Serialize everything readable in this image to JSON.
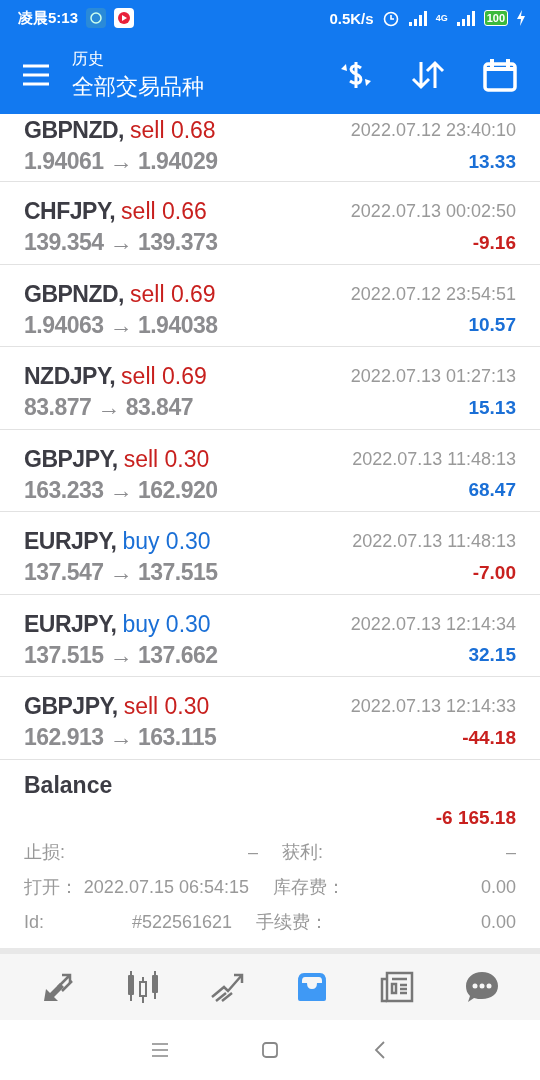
{
  "status_bar": {
    "time": "凌晨5:13",
    "speed": "0.5K/s",
    "network": "4G",
    "battery": "100"
  },
  "header": {
    "subtitle": "历史",
    "title": "全部交易品种"
  },
  "trades": [
    {
      "symbol": "GBPNZD,",
      "side": "sell 0.68",
      "kind": "sell",
      "prices": "1.94061 → 1.94029",
      "time": "2022.07.12 23:40:10",
      "profit": "13.33",
      "color": "#1a6fd6"
    },
    {
      "symbol": "CHFJPY,",
      "side": "sell 0.66",
      "kind": "sell",
      "prices": "139.354 → 139.373",
      "time": "2022.07.13 00:02:50",
      "profit": "-9.16",
      "color": "#c8201e"
    },
    {
      "symbol": "GBPNZD,",
      "side": "sell 0.69",
      "kind": "sell",
      "prices": "1.94063 → 1.94038",
      "time": "2022.07.12 23:54:51",
      "profit": "10.57",
      "color": "#1a6fd6"
    },
    {
      "symbol": "NZDJPY,",
      "side": "sell 0.69",
      "kind": "sell",
      "prices": "83.877 → 83.847",
      "time": "2022.07.13 01:27:13",
      "profit": "15.13",
      "color": "#1a6fd6"
    },
    {
      "symbol": "GBPJPY,",
      "side": "sell 0.30",
      "kind": "sell",
      "prices": "163.233 → 162.920",
      "time": "2022.07.13 11:48:13",
      "profit": "68.47",
      "color": "#1a6fd6"
    },
    {
      "symbol": "EURJPY,",
      "side": "buy 0.30",
      "kind": "buy",
      "prices": "137.547 → 137.515",
      "time": "2022.07.13 11:48:13",
      "profit": "-7.00",
      "color": "#c8201e"
    },
    {
      "symbol": "EURJPY,",
      "side": "buy 0.30",
      "kind": "buy",
      "prices": "137.515 → 137.662",
      "time": "2022.07.13 12:14:34",
      "profit": "32.15",
      "color": "#1a6fd6"
    },
    {
      "symbol": "GBPJPY,",
      "side": "sell 0.30",
      "kind": "sell",
      "prices": "162.913 → 163.115",
      "time": "2022.07.13 12:14:33",
      "profit": "-44.18",
      "color": "#c8201e"
    }
  ],
  "balance": {
    "title": "Balance",
    "amount": "-6 165.18",
    "color": "#c8201e",
    "details": [
      {
        "label": "止损:",
        "value": "–",
        "label2": "获利:",
        "value2": "–"
      },
      {
        "label": "打开：",
        "value": "2022.07.15 06:54:15",
        "label2": "库存费：",
        "value2": "0.00"
      },
      {
        "label": "Id:",
        "value": "#522561621",
        "label2": "手续费：",
        "value2": "0.00"
      }
    ]
  },
  "bottom_nav": [
    {
      "selected": false
    },
    {
      "selected": false
    },
    {
      "selected": false
    },
    {
      "selected": true
    },
    {
      "selected": false
    },
    {
      "selected": false
    }
  ]
}
